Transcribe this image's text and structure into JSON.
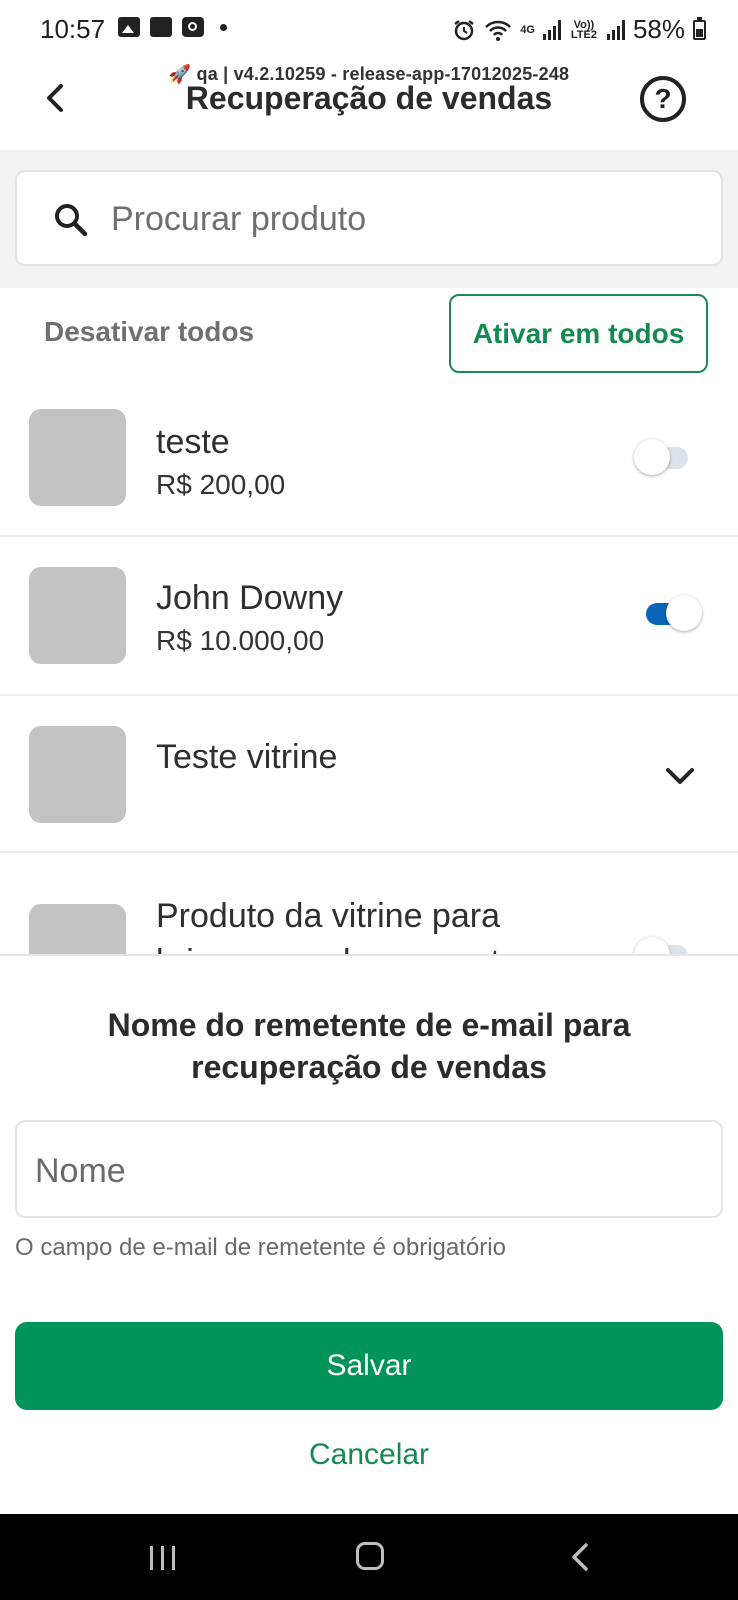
{
  "status_bar": {
    "time": "10:57",
    "network": "4G",
    "lte": "Vo)) LTE2",
    "battery": "58%",
    "icons": [
      "gallery-icon",
      "caption-icon",
      "clock-app-icon",
      "notification-dot",
      "alarm-icon",
      "wifi-icon",
      "signal-icon",
      "battery-icon"
    ]
  },
  "header": {
    "env_label": "🚀 qa | v4.2.10259 - release-app-17012025-248",
    "title": "Recuperação de vendas",
    "help_label": "?"
  },
  "search": {
    "placeholder": "Procurar produto"
  },
  "bulk_actions": {
    "deactivate_all": "Desativar todos",
    "activate_all": "Ativar em todos"
  },
  "products": [
    {
      "name": "teste",
      "price": "R$ 200,00",
      "control": "toggle",
      "enabled": false
    },
    {
      "name": "John Downy",
      "price": "R$ 10.000,00",
      "control": "toggle",
      "enabled": true
    },
    {
      "name": "Teste vitrine",
      "price": "",
      "control": "expand"
    },
    {
      "name": "Produto da vitrine para brincar com lançamento",
      "price": "",
      "control": "toggle",
      "enabled": false
    }
  ],
  "sheet": {
    "title": "Nome do remetente de e-mail para recuperação de vendas",
    "name_placeholder": "Nome",
    "error": "O campo de e-mail de remetente é obrigatório",
    "save_label": "Salvar",
    "cancel_label": "Cancelar"
  },
  "colors": {
    "primary_green": "#00935a",
    "toggle_on": "#0a66b8",
    "thumb_placeholder": "#c3c3c3"
  }
}
